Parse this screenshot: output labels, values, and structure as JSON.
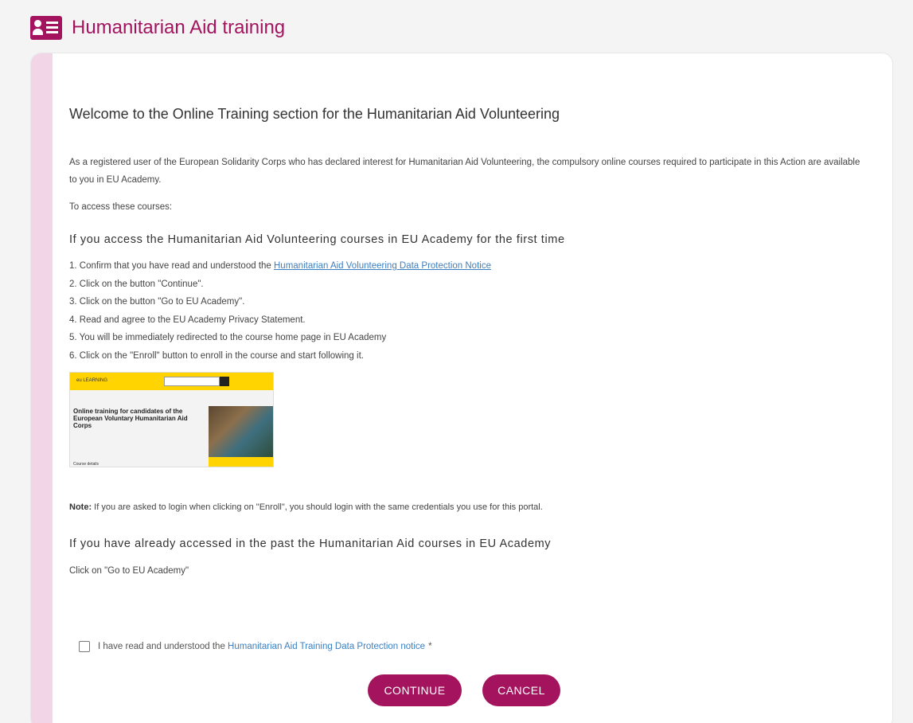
{
  "header": {
    "title": "Humanitarian Aid training",
    "accent_color": "#a3135e",
    "icon": "id-card-icon"
  },
  "main": {
    "welcome_heading": "Welcome to the Online Training section for the Humanitarian Aid Volunteering",
    "intro_text": "As a registered user of the European Solidarity Corps who has declared interest for Humanitarian Aid Volunteering, the compulsory online courses required to participate in this Action are available to you in EU Academy.",
    "access_text": "To access these courses:",
    "first_time_heading": "If you access the Humanitarian Aid Volunteering courses in EU Academy for the first time",
    "steps": {
      "s1_prefix": "1. Confirm that you have read and understood the ",
      "s1_link": "Humanitarian Aid Volunteering Data Protection Notice",
      "s2": "2. Click on the button \"Continue\".",
      "s3": "3. Click on the button \"Go to EU Academy\".",
      "s4": "4. Read and agree to the EU Academy Privacy Statement.",
      "s5": "5. You will be immediately redirected to the course home page in EU Academy",
      "s6": "6. Click on the \"Enroll\" button to enroll in the course and start following it."
    },
    "preview": {
      "logo_text": "eu LEARNING",
      "course_title": "Online training for candidates of the European Voluntary Humanitarian Aid Corps",
      "footer_text": "Course details"
    },
    "note_label": "Note:",
    "note_text": "If you are asked to login when clicking on \"Enroll\", you should login with the same credentials you use for this portal.",
    "past_heading": "If you have already accessed in the past the Humanitarian Aid courses in EU Academy",
    "past_text": "Click on \"Go to EU Academy\"",
    "agree": {
      "prefix": "I have read and understood the ",
      "link": "Humanitarian Aid Training Data Protection notice",
      "required_mark": "*"
    }
  },
  "buttons": {
    "continue_label": "CONTINUE",
    "cancel_label": "CANCEL"
  }
}
